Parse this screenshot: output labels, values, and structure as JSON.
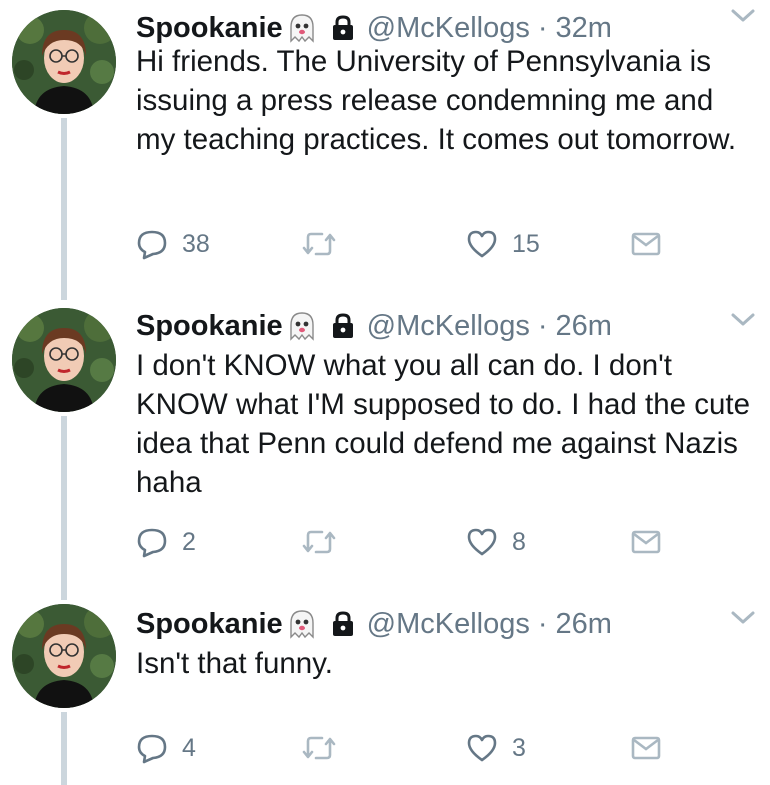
{
  "colors": {
    "text": "#14171a",
    "secondary": "#657786",
    "thread_line": "#ccd6dd",
    "icon": "#aab8c2"
  },
  "tweets": [
    {
      "name": "Spookanie",
      "name_emoji": "ghost-emoji",
      "protected_icon": "lock-icon",
      "handle": "@McKellogs",
      "separator": "·",
      "time": "32m",
      "text": "Hi friends. The University of Pennsylvania is issuing a press release condemning me and my teaching practices. It comes out tomorrow.",
      "replies": "38",
      "retweets": "",
      "likes": "15"
    },
    {
      "name": "Spookanie",
      "name_emoji": "ghost-emoji",
      "protected_icon": "lock-icon",
      "handle": "@McKellogs",
      "separator": "·",
      "time": "26m",
      "text": "I don't KNOW what you all can do. I don't KNOW what I'M supposed to do. I had the cute idea that Penn could defend me against Nazis haha",
      "replies": "2",
      "retweets": "",
      "likes": "8"
    },
    {
      "name": "Spookanie",
      "name_emoji": "ghost-emoji",
      "protected_icon": "lock-icon",
      "handle": "@McKellogs",
      "separator": "·",
      "time": "26m",
      "text": "Isn't that funny.",
      "replies": "4",
      "retweets": "",
      "likes": "3"
    }
  ]
}
